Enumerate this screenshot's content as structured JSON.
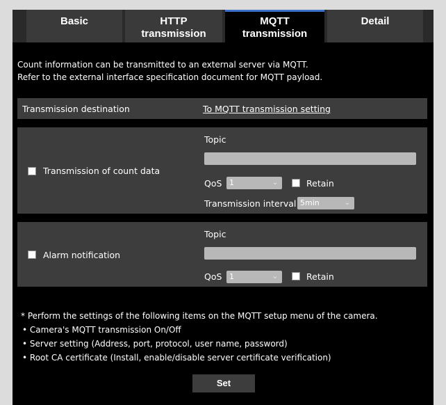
{
  "tabs": [
    {
      "label": "Basic"
    },
    {
      "label": "HTTP\ntransmission"
    },
    {
      "label": "MQTT\ntransmission",
      "active": true
    },
    {
      "label": "Detail"
    }
  ],
  "intro": {
    "line1": "Count information can be transmitted to an external server via MQTT.",
    "line2": "Refer to the external interface specification document for MQTT payload."
  },
  "destination": {
    "label": "Transmission destination",
    "link": "To MQTT transmission setting"
  },
  "count_data": {
    "checkbox_label": "Transmission of count data",
    "checked": false,
    "topic_label": "Topic",
    "topic_value": "",
    "qos_label": "QoS",
    "qos_value": "1",
    "retain_label": "Retain",
    "retain_checked": false,
    "interval_label": "Transmission interval",
    "interval_value": "5min"
  },
  "alarm": {
    "checkbox_label": "Alarm notification",
    "checked": false,
    "topic_label": "Topic",
    "topic_value": "",
    "qos_label": "QoS",
    "qos_value": "1",
    "retain_label": "Retain",
    "retain_checked": false
  },
  "notes": {
    "header": "* Perform the settings of the following items on the MQTT setup menu of the camera.",
    "items": [
      "• Camera's MQTT transmission On/Off",
      "• Server setting (Address, port, protocol, user name, password)",
      "• Root CA certificate (Install, enable/disable server certificate verification)"
    ]
  },
  "set_button": "Set",
  "colors": {
    "background": "#000000",
    "panel": "#3d3d3d",
    "tab_active_accent": "#3b6fc8",
    "disabled_control": "#b8b8b8"
  }
}
